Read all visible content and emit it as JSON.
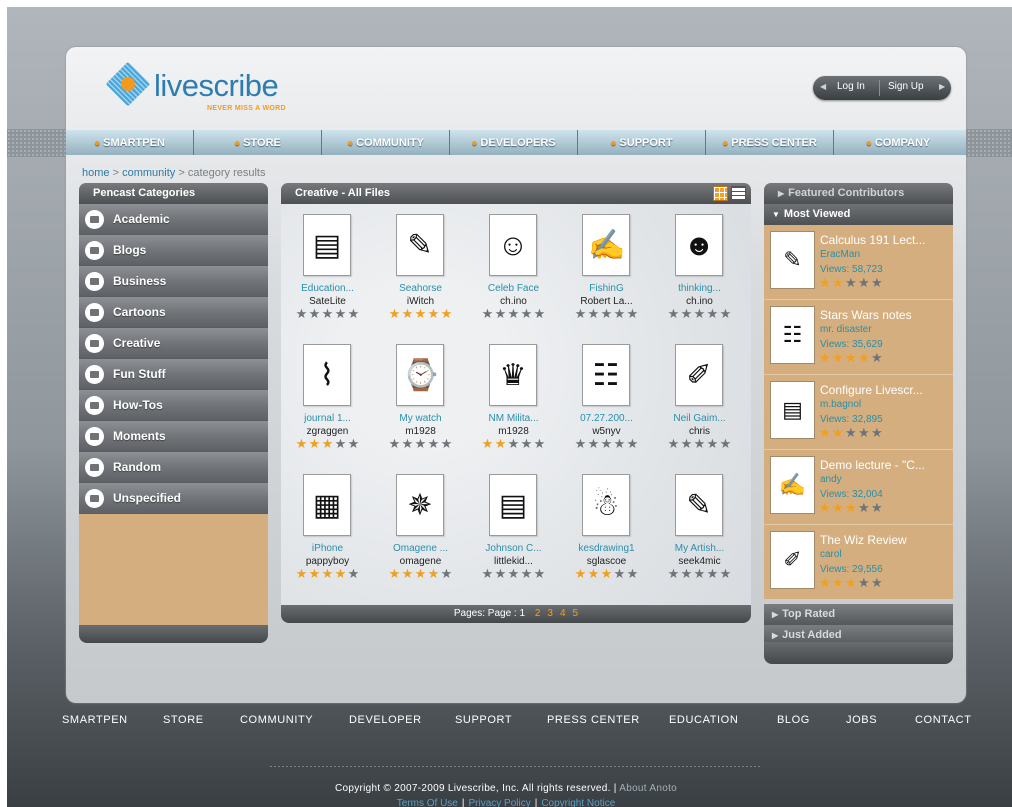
{
  "brand": {
    "name": "livescribe",
    "tagline": "NEVER MISS A WORD",
    "accent": "#f39a1e",
    "primary": "#2e7db2"
  },
  "auth": {
    "login_label": "Log In",
    "signup_label": "Sign Up"
  },
  "nav": [
    "SMARTPEN",
    "STORE",
    "COMMUNITY",
    "DEVELOPERS",
    "SUPPORT",
    "PRESS CENTER",
    "COMPANY"
  ],
  "breadcrumb": {
    "home": "home",
    "community": "community",
    "current": "category results",
    "sep": ">"
  },
  "left_panel": {
    "title": "Pencast Categories",
    "categories": [
      "Academic",
      "Blogs",
      "Business",
      "Cartoons",
      "Creative",
      "Fun Stuff",
      "How-Tos",
      "Moments",
      "Random",
      "Unspecified"
    ]
  },
  "center_panel": {
    "title": "Creative - All Files",
    "view_icons": [
      "grid-view-icon",
      "list-view-icon"
    ],
    "items": [
      {
        "title": "Education...",
        "author": "SateLite",
        "rating": 0
      },
      {
        "title": "Seahorse",
        "author": "iWitch",
        "rating": 5
      },
      {
        "title": "Celeb Face",
        "author": "ch.ino",
        "rating": 0
      },
      {
        "title": "FishinG",
        "author": "Robert La...",
        "rating": 0
      },
      {
        "title": "thinking...",
        "author": "ch.ino",
        "rating": 0
      },
      {
        "title": "journal 1...",
        "author": "zgraggen",
        "rating": 2.5
      },
      {
        "title": "My watch",
        "author": "m1928",
        "rating": 0
      },
      {
        "title": "NM Milita...",
        "author": "m1928",
        "rating": 2
      },
      {
        "title": "07.27.200...",
        "author": "w5nyv",
        "rating": 0
      },
      {
        "title": "Neil Gaim...",
        "author": "chris",
        "rating": 0
      },
      {
        "title": "iPhone",
        "author": "pappyboy",
        "rating": 3.5
      },
      {
        "title": "Omagene ...",
        "author": "omagene",
        "rating": 4
      },
      {
        "title": "Johnson C...",
        "author": "littlekid...",
        "rating": 0
      },
      {
        "title": "kesdrawing1",
        "author": "sglascoe",
        "rating": 3
      },
      {
        "title": "My Artish...",
        "author": "seek4mic",
        "rating": 0
      }
    ],
    "pagination": {
      "label": "Pages: Page :",
      "current": "1",
      "pages": [
        "2",
        "3",
        "4",
        "5"
      ]
    }
  },
  "right_panel": {
    "featured_label": "Featured Contributors",
    "most_viewed_label": "Most Viewed",
    "items": [
      {
        "title": "Calculus 191 Lect...",
        "author": "EracMan",
        "views": "Views: 58,723",
        "rating": 2
      },
      {
        "title": "Stars Wars notes",
        "author": "mr. disaster",
        "views": "Views: 35,629",
        "rating": 3.5
      },
      {
        "title": "Configure Livescr...",
        "author": "m.bagnol",
        "views": "Views: 32,895",
        "rating": 1.5
      },
      {
        "title": "Demo lecture - \"C...",
        "author": "andy",
        "views": "Views: 32,004",
        "rating": 3
      },
      {
        "title": "The Wiz Review",
        "author": "carol",
        "views": "Views: 29,556",
        "rating": 2.5
      }
    ],
    "top_rated_label": "Top Rated",
    "just_added_label": "Just Added"
  },
  "footer": {
    "nav": [
      "SMARTPEN",
      "STORE",
      "COMMUNITY",
      "DEVELOPER",
      "SUPPORT",
      "PRESS CENTER",
      "EDUCATION",
      "BLOG",
      "JOBS",
      "CONTACT"
    ],
    "copyright": "Copyright © 2007-2009 Livescribe, Inc. All rights reserved. |",
    "about": "About Anoto",
    "terms": "Terms Of Use",
    "privacy": "Privacy Policy",
    "copyright_notice": "Copyright Notice"
  }
}
